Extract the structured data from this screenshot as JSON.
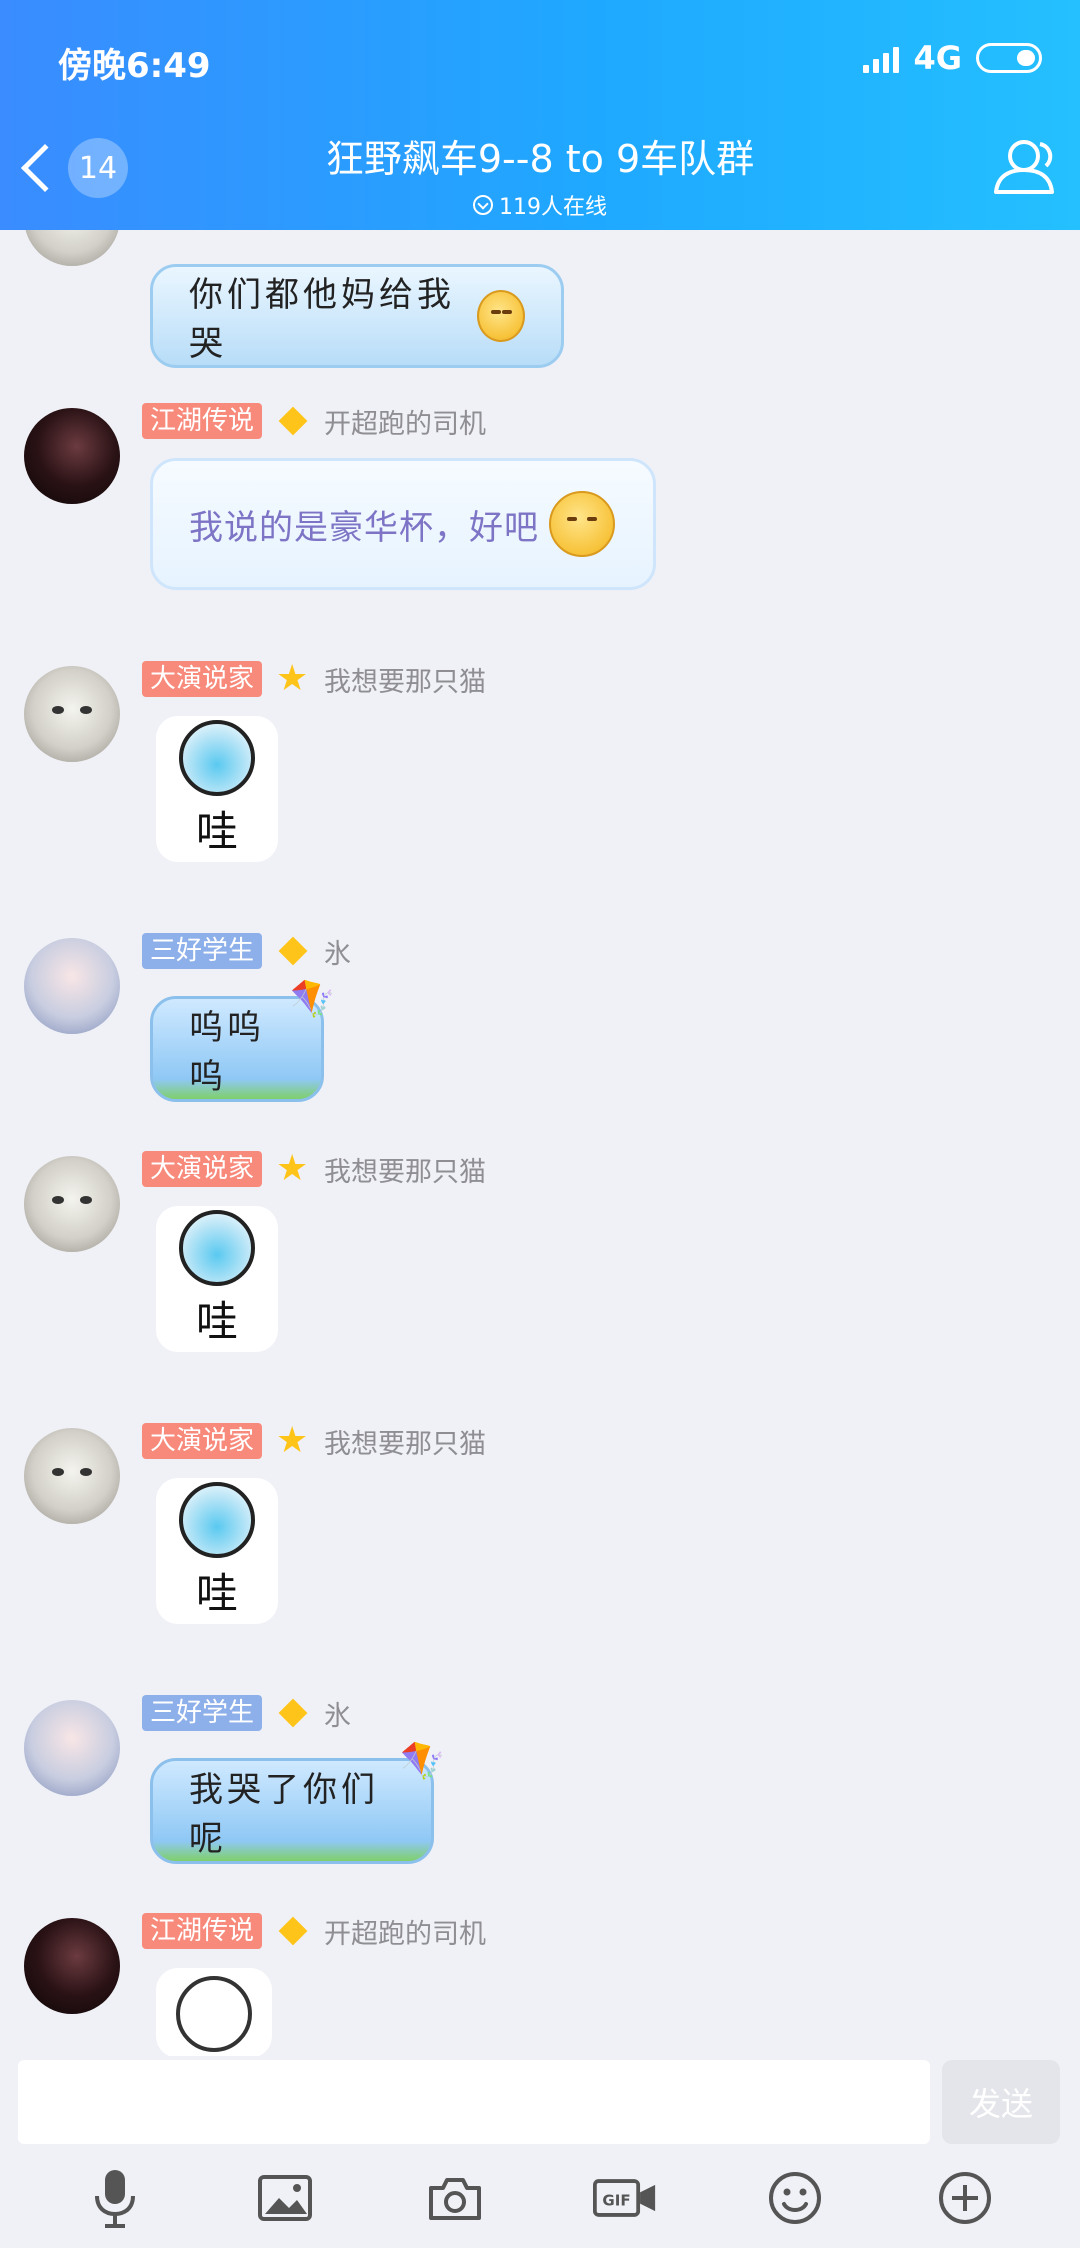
{
  "status_bar": {
    "time": "傍晚6:49",
    "network": "4G"
  },
  "header": {
    "unread_count": "14",
    "title": "狂野飙车9--8 to 9车队群",
    "online": "119人在线"
  },
  "messages": [
    {
      "type": "text",
      "text": "你们都他妈给我哭"
    },
    {
      "type": "text",
      "tag": "江湖传说",
      "nickname": "开超跑的司机",
      "text": "我说的是豪华杯，好吧"
    },
    {
      "type": "sticker",
      "tag": "大演说家",
      "nickname": "我想要那只猫",
      "sticker_text": "哇"
    },
    {
      "type": "text",
      "tag": "三好学生",
      "nickname": "氷",
      "text": "呜呜呜"
    },
    {
      "type": "sticker",
      "tag": "大演说家",
      "nickname": "我想要那只猫",
      "sticker_text": "哇"
    },
    {
      "type": "sticker",
      "tag": "大演说家",
      "nickname": "我想要那只猫",
      "sticker_text": "哇"
    },
    {
      "type": "text",
      "tag": "三好学生",
      "nickname": "氷",
      "text": "我哭了你们呢"
    },
    {
      "type": "sticker",
      "tag": "江湖传说",
      "nickname": "开超跑的司机"
    }
  ],
  "input": {
    "placeholder": "",
    "send_label": "发送"
  },
  "toolbar": [
    "microphone-icon",
    "image-icon",
    "camera-icon",
    "gif-icon",
    "emoji-icon",
    "plus-icon"
  ],
  "colors": {
    "header_start": "#3a8cff",
    "header_end": "#24c0ff",
    "tag_red": "#f88a7c",
    "tag_blue": "#8eb0ea",
    "chat_bg": "#f0f1f6"
  }
}
